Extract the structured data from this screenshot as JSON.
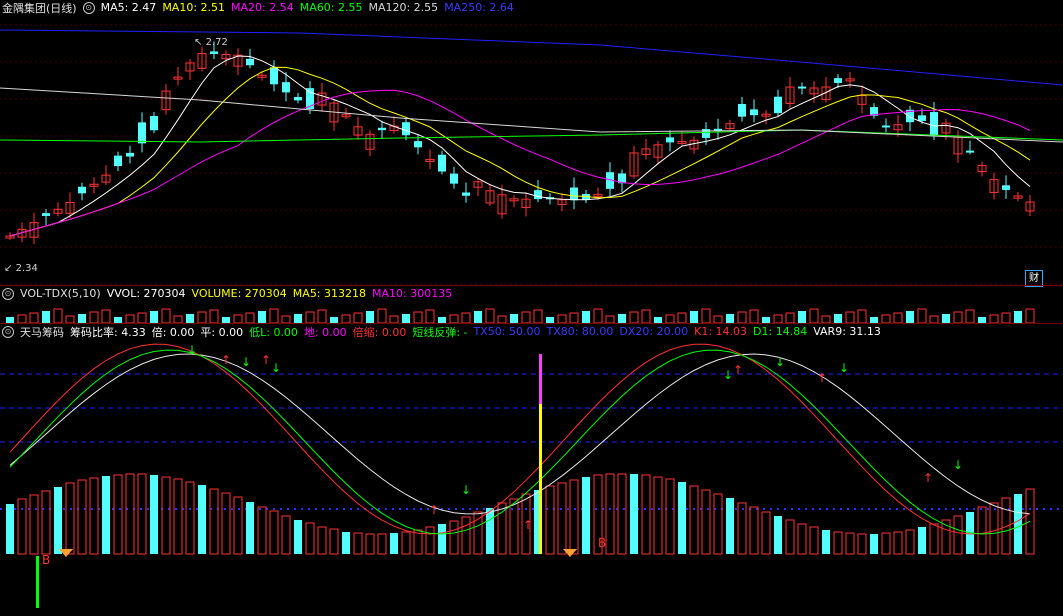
{
  "price_header": {
    "title": "金隅集团(日线)",
    "ma5": "MA5: 2.47",
    "ma10": "MA10: 2.51",
    "ma20": "MA20: 2.54",
    "ma60": "MA60: 2.55",
    "ma120": "MA120: 2.55",
    "ma250": "MA250: 2.64"
  },
  "price_markers": {
    "high": "2.72",
    "low": "2.34",
    "cai": "财"
  },
  "vol_header": {
    "name": "VOL-TDX(5,10)",
    "vvol": "VVOL: 270304",
    "volume": "VOLUME: 270304",
    "ma5": "MA5: 313218",
    "ma10": "MA10: 300135"
  },
  "ind_header": {
    "name": "天马筹码",
    "ratio": "筹码比率: 4.33",
    "bei": "倍: 0.00",
    "ping": "平: 0.00",
    "low": "低L: 0.00",
    "di": "地: 0.00",
    "beisuo": "倍缩: 0.00",
    "duan": "短线反弹: -",
    "tx50": "TX50: 50.00",
    "tx80": "TX80: 80.00",
    "dx20": "DX20: 20.00",
    "k1": "K1: 14.03",
    "d1": "D1: 14.84",
    "var9": "VAR9: 31.13"
  },
  "ind_markers": {
    "b1": "B",
    "b2": "B"
  },
  "colors": {
    "up": "#ff3232",
    "down": "#54ffff",
    "ma5": "#ffffff",
    "ma10": "#ffff00",
    "ma20": "#ff00ff",
    "ma60": "#00ff00",
    "ma120": "#d8d8d8",
    "ma250": "#2020ff"
  }
}
